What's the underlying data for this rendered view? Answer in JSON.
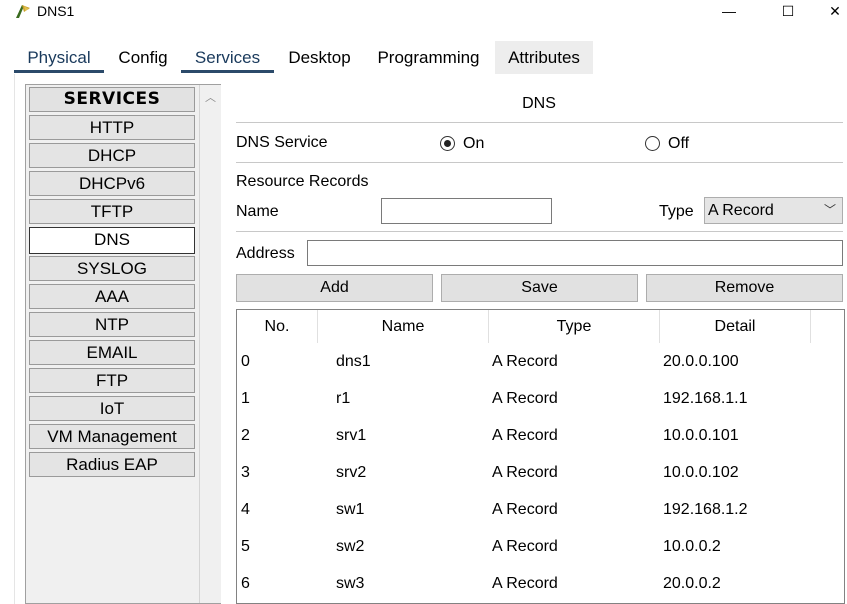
{
  "window": {
    "title": "DNS1",
    "min_glyph": "—",
    "max_glyph": "☐",
    "close_glyph": "✕"
  },
  "tabs": [
    "Physical",
    "Config",
    "Services",
    "Desktop",
    "Programming",
    "Attributes"
  ],
  "services": {
    "header": "SERVICES",
    "items": [
      "HTTP",
      "DHCP",
      "DHCPv6",
      "TFTP",
      "DNS",
      "SYSLOG",
      "AAA",
      "NTP",
      "EMAIL",
      "FTP",
      "IoT",
      "VM Management",
      "Radius EAP"
    ],
    "selected": "DNS"
  },
  "dns": {
    "title": "DNS",
    "service_label": "DNS Service",
    "on_label": "On",
    "off_label": "Off",
    "service_state": "On",
    "resource_records_label": "Resource Records",
    "name_label": "Name",
    "name_value": "",
    "type_label": "Type",
    "type_value": "A Record",
    "address_label": "Address",
    "address_value": "",
    "buttons": {
      "add": "Add",
      "save": "Save",
      "remove": "Remove"
    }
  },
  "table": {
    "columns": [
      "No.",
      "Name",
      "Type",
      "Detail"
    ],
    "rows": [
      [
        "0",
        "dns1",
        "A Record",
        "20.0.0.100"
      ],
      [
        "1",
        "r1",
        "A Record",
        "192.168.1.1"
      ],
      [
        "2",
        "srv1",
        "A Record",
        "10.0.0.101"
      ],
      [
        "3",
        "srv2",
        "A Record",
        "10.0.0.102"
      ],
      [
        "4",
        "sw1",
        "A Record",
        "192.168.1.2"
      ],
      [
        "5",
        "sw2",
        "A Record",
        "10.0.0.2"
      ],
      [
        "6",
        "sw3",
        "A Record",
        "20.0.0.2"
      ]
    ]
  }
}
